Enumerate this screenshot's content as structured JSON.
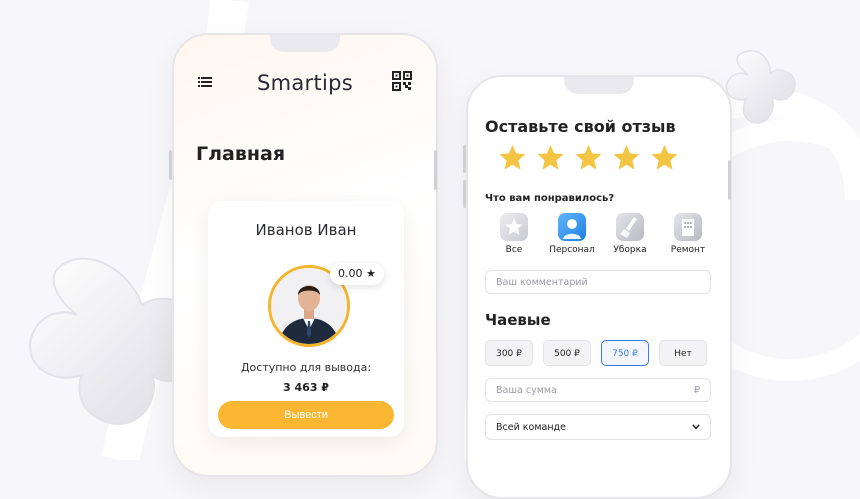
{
  "app": {
    "title": "Smartips"
  },
  "home": {
    "title": "Главная",
    "user_name": "Иванов Иван",
    "rating": "0.00 ★",
    "available_label": "Доступно для вывода:",
    "available_amount": "3 463 ₽",
    "withdraw_label": "Вывести"
  },
  "review": {
    "title": "Оставьте свой отзыв",
    "stars_total": 5,
    "liked_question": "Что вам понравилось?",
    "categories": [
      {
        "label": "Все",
        "icon": "all-icon"
      },
      {
        "label": "Персонал",
        "icon": "staff-icon"
      },
      {
        "label": "Уборка",
        "icon": "cleaning-icon"
      },
      {
        "label": "Ремонт",
        "icon": "repair-icon"
      }
    ],
    "comment_placeholder": "Ваш комментарий"
  },
  "tips": {
    "title": "Чаевые",
    "options": [
      {
        "label": "300 ₽",
        "selected": false
      },
      {
        "label": "500 ₽",
        "selected": false
      },
      {
        "label": "750 ₽",
        "selected": true
      },
      {
        "label": "Нет",
        "selected": false
      }
    ],
    "amount_placeholder": "Ваша сумма",
    "currency": "₽",
    "recipient_value": "Всей команде"
  },
  "colors": {
    "accent": "#fbb731",
    "selected": "#3b7be8",
    "star": "#f4c542"
  }
}
